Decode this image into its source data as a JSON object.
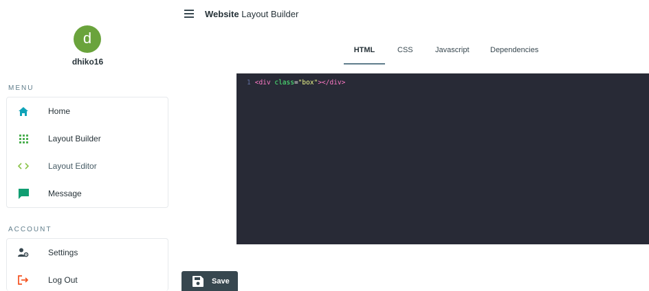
{
  "header": {
    "title_bold": "Website",
    "title_rest": "Layout Builder"
  },
  "profile": {
    "avatar_letter": "d",
    "username": "dhiko16",
    "avatar_color": "#6aa33c"
  },
  "menu": {
    "title": "MENU",
    "items": [
      {
        "label": "Home",
        "icon": "home-icon"
      },
      {
        "label": "Layout Builder",
        "icon": "grid-icon"
      },
      {
        "label": "Layout Editor",
        "icon": "code-icon"
      },
      {
        "label": "Message",
        "icon": "message-icon"
      }
    ]
  },
  "account": {
    "title": "ACCOUNT",
    "items": [
      {
        "label": "Settings",
        "icon": "user-settings-icon"
      },
      {
        "label": "Log Out",
        "icon": "logout-icon"
      }
    ]
  },
  "tabs": [
    {
      "label": "HTML",
      "active": true
    },
    {
      "label": "CSS",
      "active": false
    },
    {
      "label": "Javascript",
      "active": false
    },
    {
      "label": "Dependencies",
      "active": false
    }
  ],
  "editor": {
    "line_number": "1",
    "open_tag": "<div",
    "attr_name": "class",
    "equals": "=",
    "attr_value": "\"box\"",
    "close_tags": "></div>"
  },
  "save": {
    "label": "Save"
  },
  "colors": {
    "editor_bg": "#282a36",
    "button_bg": "#37474f",
    "home_icon": "#0fa3b8",
    "grid_icon": "#4caf50",
    "code_icon": "#8bc34a",
    "message_icon": "#109e72",
    "logout_icon": "#f4511e"
  }
}
